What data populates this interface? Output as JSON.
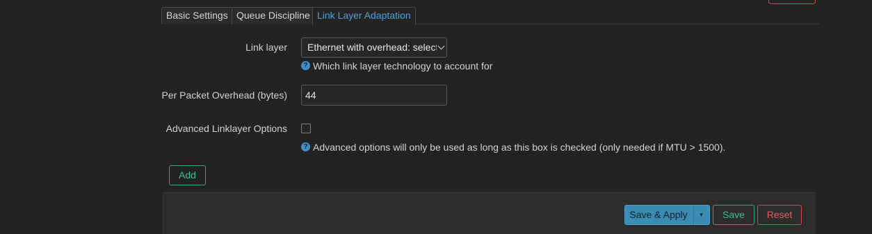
{
  "tabs": [
    {
      "label": "Basic Settings",
      "active": false
    },
    {
      "label": "Queue Discipline",
      "active": false
    },
    {
      "label": "Link Layer Adaptation",
      "active": true
    }
  ],
  "form": {
    "link_layer": {
      "label": "Link layer",
      "value": "Ethernet with overhead: select f",
      "help": "Which link layer technology to account for"
    },
    "overhead": {
      "label": "Per Packet Overhead (bytes)",
      "value": "44"
    },
    "advanced": {
      "label": "Advanced Linklayer Options",
      "checked": false,
      "help": "Advanced options will only be used as long as this box is checked (only needed if MTU > 1500)."
    },
    "add_label": "Add"
  },
  "actions": {
    "save_apply": "Save & Apply",
    "dropdown_glyph": "▾",
    "save": "Save",
    "reset": "Reset"
  },
  "icons": {
    "help_glyph": "?"
  },
  "colors": {
    "accent_blue": "#3a8cb4",
    "tab_active": "#4aa3d8",
    "positive": "#3bbf8b",
    "negative": "#d9625e"
  }
}
